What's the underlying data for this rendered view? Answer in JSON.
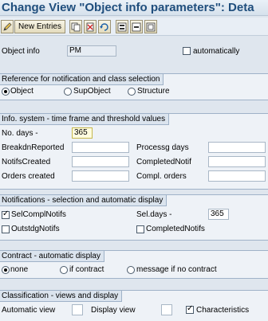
{
  "window": {
    "title": "Change View \"Object info parameters\": Deta"
  },
  "toolbar": {
    "new_entries_label": "New Entries",
    "icons": [
      "edit-icon",
      "copy-icon",
      "delete-icon",
      "undo-icon",
      "select-all-icon",
      "select-block-icon",
      "deselect-all-icon"
    ]
  },
  "header": {
    "object_info_label": "Object info",
    "object_info_value": "PM",
    "automatically_label": "automatically",
    "automatically_checked": false
  },
  "reference": {
    "title": "Reference for notification and class selection",
    "options": [
      "Object",
      "SupObject",
      "Structure"
    ],
    "selected": "Object"
  },
  "info_system": {
    "title": "Info. system - time frame and threshold values",
    "no_days_label": "No. days -",
    "no_days_value": "365",
    "breakdn_label": "BreakdnReported",
    "processg_label": "Processg days",
    "notifs_created_label": "NotifsCreated",
    "completed_notif_label": "CompletedNotif",
    "orders_created_label": "Orders created",
    "compl_orders_label": "Compl. orders"
  },
  "notifications": {
    "title": "Notifications - selection and automatic display",
    "selcompl_label": "SelComplNotifs",
    "selcompl_checked": true,
    "sel_days_label": "Sel.days -",
    "sel_days_value": "365",
    "outstdg_label": "OutstdgNotifs",
    "outstdg_checked": false,
    "completed_label": "CompletedNotifs",
    "completed_checked": false
  },
  "contract": {
    "title": "Contract - automatic display",
    "options": [
      "none",
      "if contract",
      "message if no contract"
    ],
    "selected": "none"
  },
  "classification": {
    "title": "Classification - views and display",
    "automatic_view_label": "Automatic view",
    "display_view_label": "Display view",
    "characteristics_label": "Characteristics",
    "characteristics_checked": true
  }
}
